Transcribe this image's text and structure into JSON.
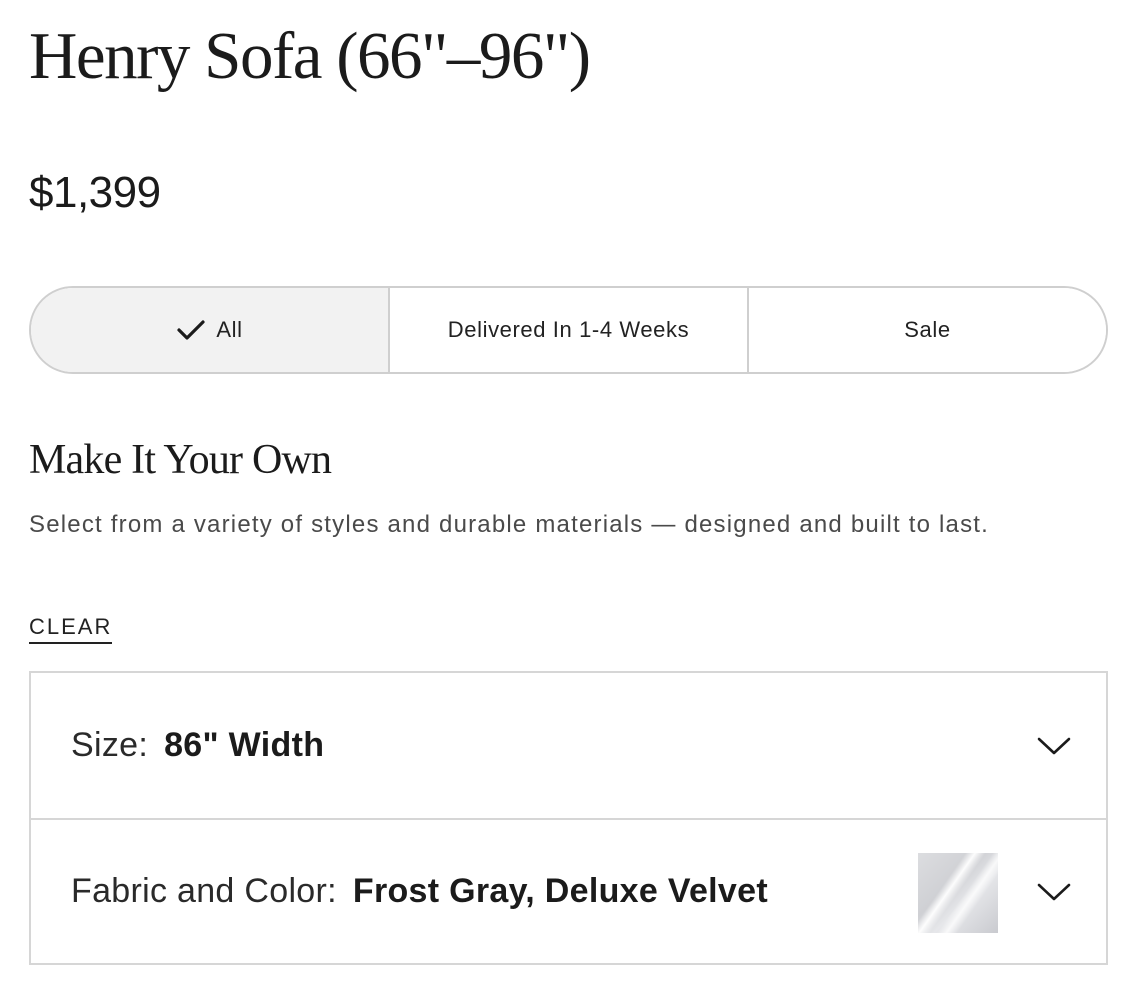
{
  "product": {
    "title": "Henry Sofa (66\"–96\")",
    "price": "$1,399"
  },
  "filters": {
    "items": [
      {
        "label": "All",
        "selected": true,
        "icon": "check-icon"
      },
      {
        "label": "Delivered In 1-4 Weeks",
        "selected": false
      },
      {
        "label": "Sale",
        "selected": false
      }
    ]
  },
  "customize": {
    "title": "Make It Your Own",
    "description": "Select from a variety of styles and durable materials — designed and built to last.",
    "clear_label": "CLEAR"
  },
  "options": [
    {
      "label": "Size:",
      "value": "86\" Width",
      "icon": "chevron-down-icon"
    },
    {
      "label": "Fabric and Color:",
      "value": "Frost Gray, Deluxe Velvet",
      "swatch": "frost-gray-velvet-swatch",
      "icon": "chevron-down-icon"
    }
  ],
  "colors": {
    "active_filter_bg": "#f2f2f2",
    "border": "#cfcfcf",
    "text": "#1b1b1b"
  }
}
